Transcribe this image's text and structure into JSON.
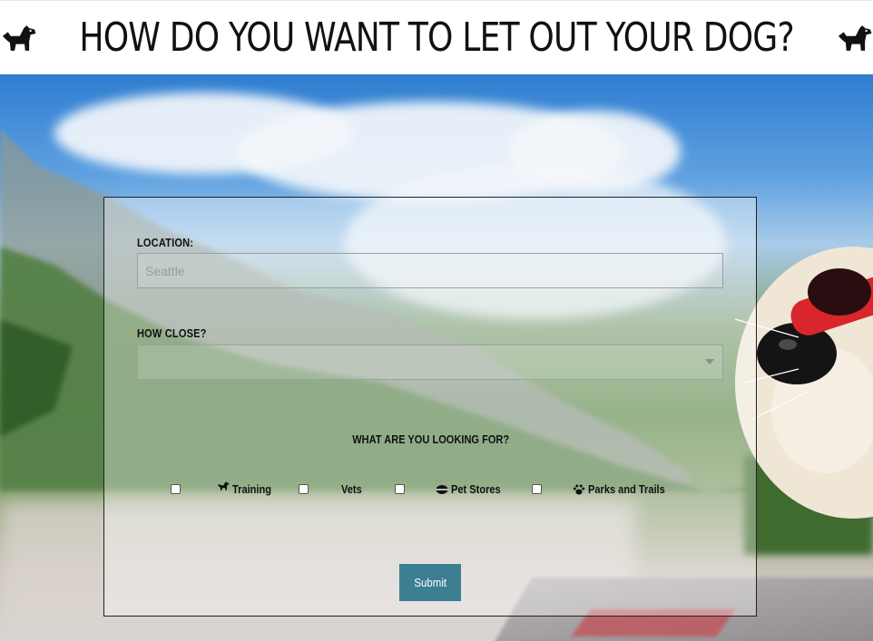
{
  "header": {
    "title": "HOW DO YOU WANT TO LET OUT YOUR DOG?",
    "left_icon": "dog-icon",
    "right_icon": "dog-icon"
  },
  "form": {
    "location_label": "LOCATION:",
    "location_placeholder": "Seattle",
    "distance_label": "HOW CLOSE?",
    "distance_selected": "",
    "looking_for_label": "WHAT ARE YOU LOOKING FOR?",
    "options": [
      {
        "label": "Training",
        "icon": "dog-icon",
        "checked": false
      },
      {
        "label": "Vets",
        "icon": "",
        "checked": false
      },
      {
        "label": "Pet Stores",
        "icon": "bowl-icon",
        "checked": false
      },
      {
        "label": "Parks and Trails",
        "icon": "paw-icon",
        "checked": false
      }
    ],
    "submit_label": "Submit"
  },
  "colors": {
    "submit_button": "#3d7f92",
    "panel_border": "#222222"
  }
}
